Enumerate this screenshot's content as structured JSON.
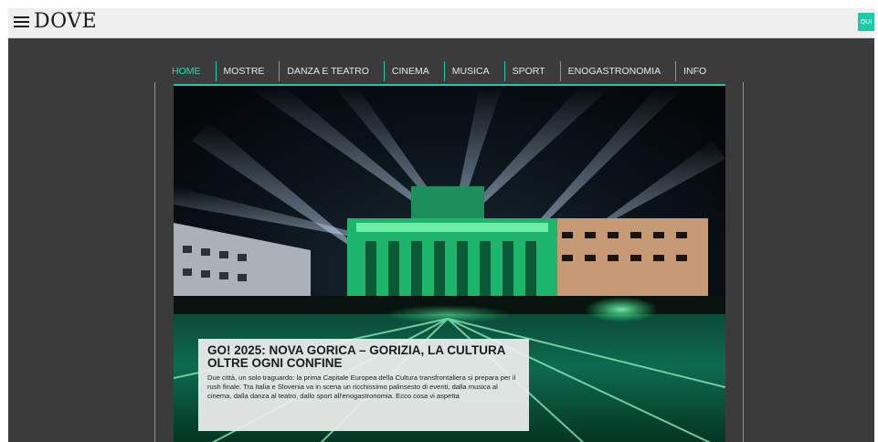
{
  "topbar": {
    "logo": "DOVE",
    "menu_icon": "hamburger-menu-icon",
    "badge_text": "QUI",
    "badge_color": "#1ec9a9"
  },
  "nav": {
    "items": [
      {
        "label": "HOME",
        "active": true
      },
      {
        "label": "MOSTRE",
        "active": false
      },
      {
        "label": "DANZA E TEATRO",
        "active": false
      },
      {
        "label": "CINEMA",
        "active": false
      },
      {
        "label": "MUSICA",
        "active": false
      },
      {
        "label": "SPORT",
        "active": false
      },
      {
        "label": "ENOGASTRONOMIA",
        "active": false
      },
      {
        "label": "INFO",
        "active": false
      }
    ]
  },
  "hero": {
    "title": "GO! 2025: NOVA GORICA – GORIZIA, LA CULTURA OLTRE OGNI CONFINE",
    "text": "Due città, un solo traguardo: la prima Capitale Europea della Cultura transfrontaliera si prepara per il rush finale. Tra Italia e Slovenia va in scena un ricchissimo palinsesto di eventi, dalla musica al cinema, dalla danza al teatro, dallo sport all'enogastronomia. Ecco cosa vi aspetta"
  },
  "colors": {
    "accent": "#1ec9a9",
    "background": "#3b3b3b",
    "topbar": "#efefef"
  }
}
